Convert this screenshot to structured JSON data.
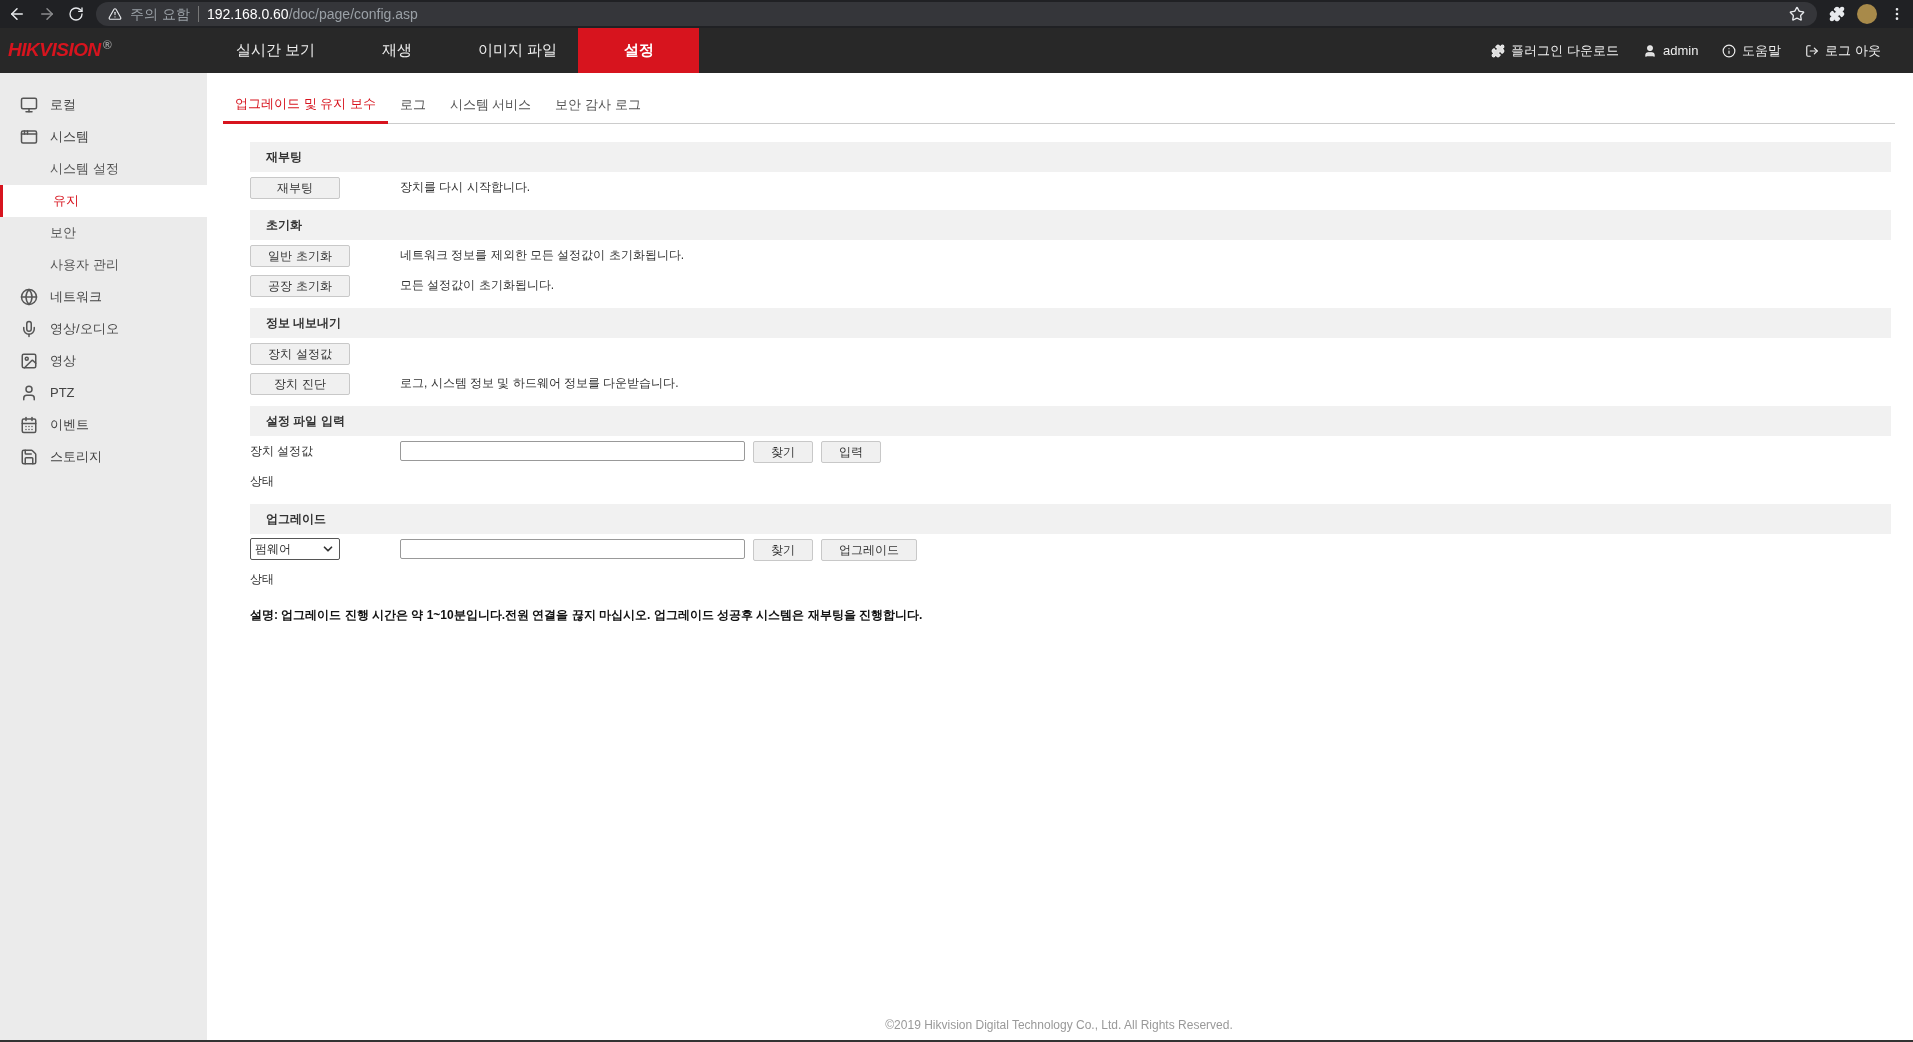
{
  "browser": {
    "warning": "주의 요함",
    "host": "192.168.0.60",
    "path": "/doc/page/config.asp"
  },
  "header": {
    "logo": "HIKVISION",
    "logo_mark": "®",
    "nav": [
      {
        "label": "실시간 보기",
        "selected": false
      },
      {
        "label": "재생",
        "selected": false
      },
      {
        "label": "이미지 파일",
        "selected": false
      },
      {
        "label": "설정",
        "selected": true
      }
    ],
    "actions": [
      "플러그인 다운로드",
      "admin",
      "도움말",
      "로그 아웃"
    ]
  },
  "sidebar": {
    "items": [
      {
        "label": "로컬",
        "selected": false
      },
      {
        "label": "시스템",
        "selected": false,
        "children": [
          {
            "label": "시스템 설정",
            "selected": false
          },
          {
            "label": "유지",
            "selected": true
          },
          {
            "label": "보안",
            "selected": false
          },
          {
            "label": "사용자 관리",
            "selected": false
          }
        ]
      },
      {
        "label": "네트워크",
        "selected": false
      },
      {
        "label": "영상/오디오",
        "selected": false
      },
      {
        "label": "영상",
        "selected": false
      },
      {
        "label": "PTZ",
        "selected": false
      },
      {
        "label": "이벤트",
        "selected": false
      },
      {
        "label": "스토리지",
        "selected": false
      }
    ]
  },
  "tabs": [
    {
      "label": "업그레이드 및 유지 보수",
      "selected": true
    },
    {
      "label": "로그",
      "selected": false
    },
    {
      "label": "시스템 서비스",
      "selected": false
    },
    {
      "label": "보안 감사 로그",
      "selected": false
    }
  ],
  "sections": [
    {
      "title": "재부팅",
      "rows": [
        {
          "kind": "action",
          "button": "재부팅",
          "description": "장치를 다시 시작합니다."
        }
      ]
    },
    {
      "title": "초기화",
      "rows": [
        {
          "kind": "action",
          "button": "일반 초기화",
          "description": "네트워크 정보를 제외한 모든 설정값이 초기화됩니다."
        },
        {
          "kind": "action",
          "button": "공장 초기화",
          "description": "모든 설정값이 초기화됩니다."
        }
      ]
    },
    {
      "title": "정보 내보내기",
      "rows": [
        {
          "kind": "action",
          "button": "장치 설정값"
        },
        {
          "kind": "action",
          "button": "장치 진단",
          "description": "로그, 시스템 정보 및 하드웨어 정보를 다운받습니다."
        }
      ]
    },
    {
      "title": "설정 파일 입력",
      "rows": [
        {
          "kind": "file",
          "label": "장치 설정값",
          "buttons": [
            "찾기",
            "입력"
          ]
        },
        {
          "kind": "status",
          "label": "상태"
        }
      ]
    },
    {
      "title": "업그레이드",
      "rows": [
        {
          "kind": "select-file",
          "select": "펌웨어",
          "buttons": [
            "찾기",
            "업그레이드"
          ]
        },
        {
          "kind": "status",
          "label": "상태"
        }
      ]
    }
  ],
  "note": "설명: 업그레이드 진행 시간은 약 1~10분입니다.전원 연결을 끊지 마십시오. 업그레이드 성공후 시스템은 재부팅을 진행합니다.",
  "footer": "©2019 Hikvision Digital Technology Co., Ltd. All Rights Reserved."
}
